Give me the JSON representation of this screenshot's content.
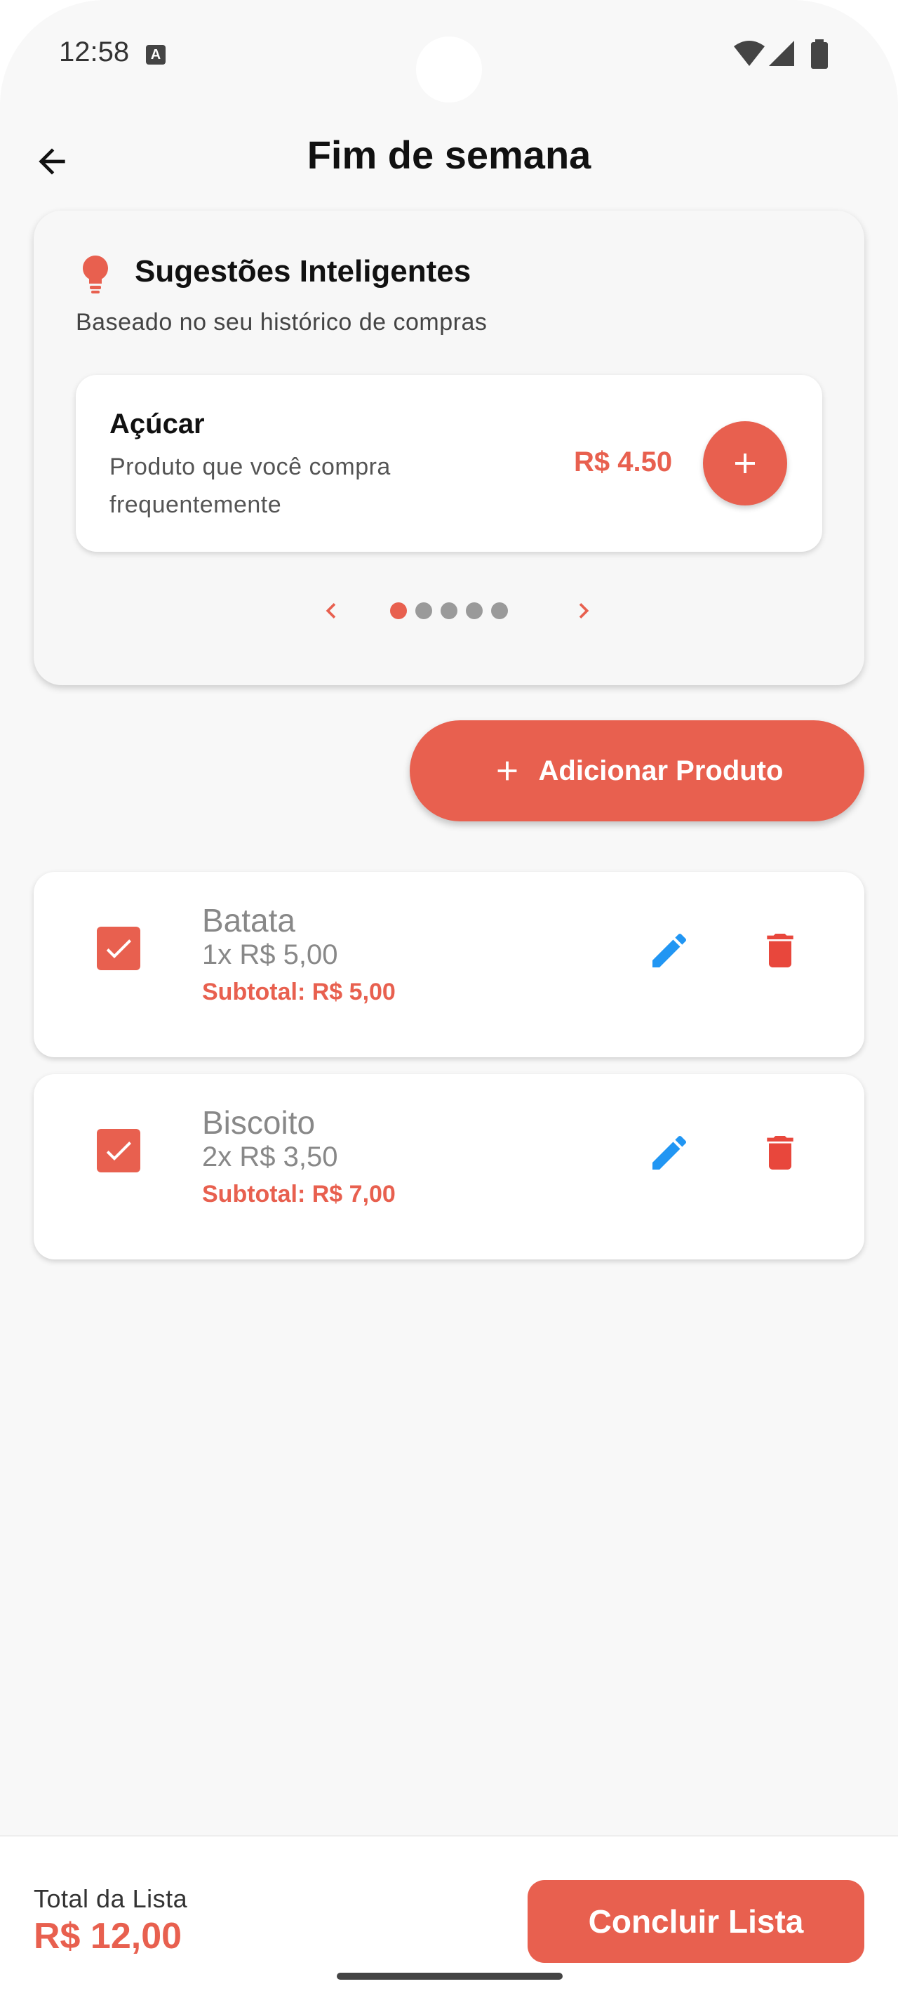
{
  "status_bar": {
    "time": "12:58",
    "notification_icon": "A"
  },
  "app_bar": {
    "title": "Fim de semana",
    "back_icon": "arrow-left-icon"
  },
  "suggestions": {
    "title": "Sugestões Inteligentes",
    "subtitle": "Baseado no seu histórico de compras",
    "icon": "lightbulb-icon",
    "current": {
      "name": "Açúcar",
      "description": "Produto que você compra frequentemente",
      "price": "R$ 4.50"
    },
    "page_count": 5,
    "active_page": 0
  },
  "add_product": {
    "label": "Adicionar Produto"
  },
  "items": [
    {
      "name": "Batata",
      "qty": "1x R$ 5,00",
      "subtotal": "Subtotal: R$ 5,00",
      "checked": true
    },
    {
      "name": "Biscoito",
      "qty": "2x R$ 3,50",
      "subtotal": "Subtotal: R$ 7,00",
      "checked": true
    }
  ],
  "footer": {
    "total_label": "Total da Lista",
    "total_value": "R$ 12,00",
    "finish_label": "Concluir Lista"
  },
  "colors": {
    "accent": "#e8604f",
    "edit": "#2196f3",
    "delete": "#e8473c",
    "background": "#f8f8f8"
  }
}
